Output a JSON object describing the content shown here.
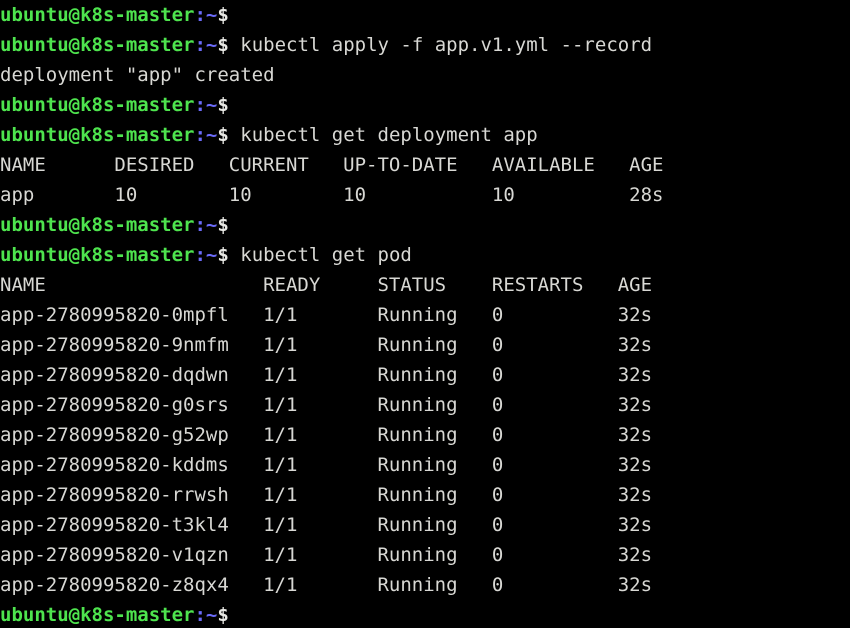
{
  "terminal": {
    "shell_user": "ubuntu",
    "shell_host": "k8s-master",
    "prompt_user_host": "ubuntu@k8s-master",
    "prompt_path": ":~",
    "prompt_symbol": "$",
    "background_color": "#000000",
    "prompt_color": "#4ee44e",
    "path_color": "#6b6bfa",
    "text_color": "#d8d8d4",
    "columns": 61,
    "rows": 21
  },
  "commands": {
    "apply": "kubectl apply -f app.v1.yml --record",
    "get_deployment": "kubectl get deployment app",
    "get_pod": "kubectl get pod"
  },
  "output": {
    "apply_result": "deployment \"app\" created"
  },
  "deployment_table": {
    "headers": [
      "NAME",
      "DESIRED",
      "CURRENT",
      "UP-TO-DATE",
      "AVAILABLE",
      "AGE"
    ],
    "header_line": "NAME      DESIRED   CURRENT   UP-TO-DATE   AVAILABLE   AGE",
    "rows": [
      {
        "line": "app       10        10        10           10          28s",
        "name": "app",
        "desired": "10",
        "current": "10",
        "up_to_date": "10",
        "available": "10",
        "age": "28s"
      }
    ]
  },
  "pod_table": {
    "headers": [
      "NAME",
      "READY",
      "STATUS",
      "RESTARTS",
      "AGE"
    ],
    "header_line": "NAME                   READY     STATUS    RESTARTS   AGE",
    "rows": [
      {
        "line": "app-2780995820-0mpfl   1/1       Running   0          32s",
        "name": "app-2780995820-0mpfl",
        "ready": "1/1",
        "status": "Running",
        "restarts": "0",
        "age": "32s"
      },
      {
        "line": "app-2780995820-9nmfm   1/1       Running   0          32s",
        "name": "app-2780995820-9nmfm",
        "ready": "1/1",
        "status": "Running",
        "restarts": "0",
        "age": "32s"
      },
      {
        "line": "app-2780995820-dqdwn   1/1       Running   0          32s",
        "name": "app-2780995820-dqdwn",
        "ready": "1/1",
        "status": "Running",
        "restarts": "0",
        "age": "32s"
      },
      {
        "line": "app-2780995820-g0srs   1/1       Running   0          32s",
        "name": "app-2780995820-g0srs",
        "ready": "1/1",
        "status": "Running",
        "restarts": "0",
        "age": "32s"
      },
      {
        "line": "app-2780995820-g52wp   1/1       Running   0          32s",
        "name": "app-2780995820-g52wp",
        "ready": "1/1",
        "status": "Running",
        "restarts": "0",
        "age": "32s"
      },
      {
        "line": "app-2780995820-kddms   1/1       Running   0          32s",
        "name": "app-2780995820-kddms",
        "ready": "1/1",
        "status": "Running",
        "restarts": "0",
        "age": "32s"
      },
      {
        "line": "app-2780995820-rrwsh   1/1       Running   0          32s",
        "name": "app-2780995820-rrwsh",
        "ready": "1/1",
        "status": "Running",
        "restarts": "0",
        "age": "32s"
      },
      {
        "line": "app-2780995820-t3kl4   1/1       Running   0          32s",
        "name": "app-2780995820-t3kl4",
        "ready": "1/1",
        "status": "Running",
        "restarts": "0",
        "age": "32s"
      },
      {
        "line": "app-2780995820-v1qzn   1/1       Running   0          32s",
        "name": "app-2780995820-v1qzn",
        "ready": "1/1",
        "status": "Running",
        "restarts": "0",
        "age": "32s"
      },
      {
        "line": "app-2780995820-z8qx4   1/1       Running   0          32s",
        "name": "app-2780995820-z8qx4",
        "ready": "1/1",
        "status": "Running",
        "restarts": "0",
        "age": "32s"
      }
    ]
  }
}
